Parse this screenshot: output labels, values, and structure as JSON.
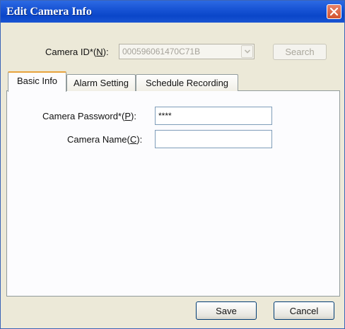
{
  "window": {
    "title": "Edit Camera Info"
  },
  "camera_id": {
    "label": "Camera ID*(",
    "accel": "N",
    "label_end": "):",
    "value": "000596061470C71B"
  },
  "search_button": {
    "label": "Search"
  },
  "tabs": [
    {
      "label": "Basic Info",
      "active": true
    },
    {
      "label": "Alarm Setting",
      "active": false
    },
    {
      "label": "Schedule Recording",
      "active": false
    }
  ],
  "password": {
    "label": "Camera Password*(",
    "accel": "P",
    "label_end": "):",
    "value": "****"
  },
  "name": {
    "label": "Camera Name(",
    "accel": "C",
    "label_end": "):",
    "value": ""
  },
  "buttons": {
    "save": "Save",
    "cancel": "Cancel"
  },
  "icons": {
    "close": "close-icon",
    "dropdown": "chevron-down-icon"
  },
  "colors": {
    "titlebar": "#0a46c9",
    "close": "#d2532f",
    "tab_highlight": "#e8a33d",
    "dialog_bg": "#ece9d8"
  }
}
